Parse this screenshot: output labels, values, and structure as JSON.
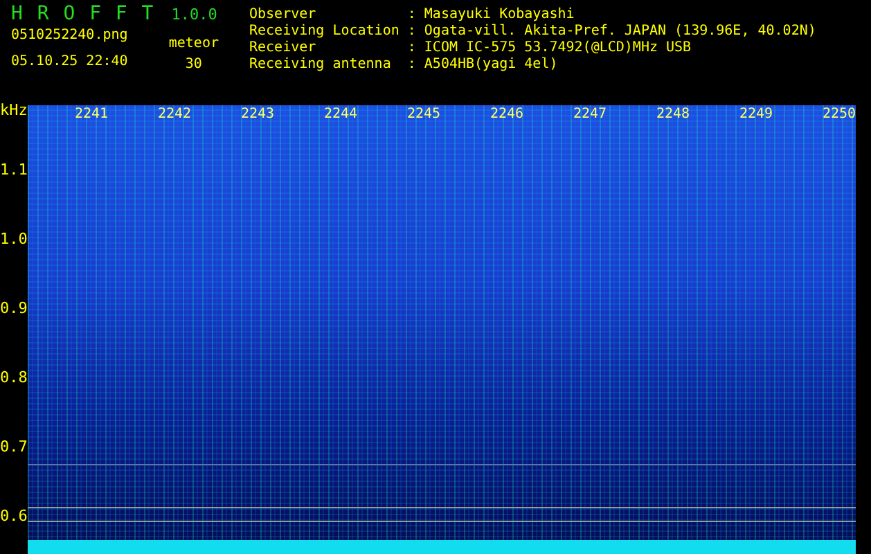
{
  "app": {
    "name": "H R O F F T",
    "version": "1.0.0"
  },
  "file": {
    "name": "0510252240.png",
    "datetime": "05.10.25 22:40"
  },
  "mode": {
    "label": "meteor",
    "value": "30"
  },
  "info": [
    {
      "label": "Observer",
      "value": ": Masayuki Kobayashi"
    },
    {
      "label": "Receiving Location",
      "value": ": Ogata-vill. Akita-Pref. JAPAN (139.96E, 40.02N)"
    },
    {
      "label": "Receiver",
      "value": ": ICOM IC-575 53.7492(@LCD)MHz USB"
    },
    {
      "label": "Receiving antenna",
      "value": ": A504HB(yagi 4el)"
    }
  ],
  "spectrogram": {
    "unit": "kHz",
    "y_labels": [
      "1.1",
      "1.0",
      "0.9",
      "0.8",
      "0.7",
      "0.6"
    ],
    "time_labels": [
      "2241",
      "2242",
      "2243",
      "2244",
      "2245",
      "2246",
      "2247",
      "2248",
      "2249",
      "2250"
    ]
  }
}
